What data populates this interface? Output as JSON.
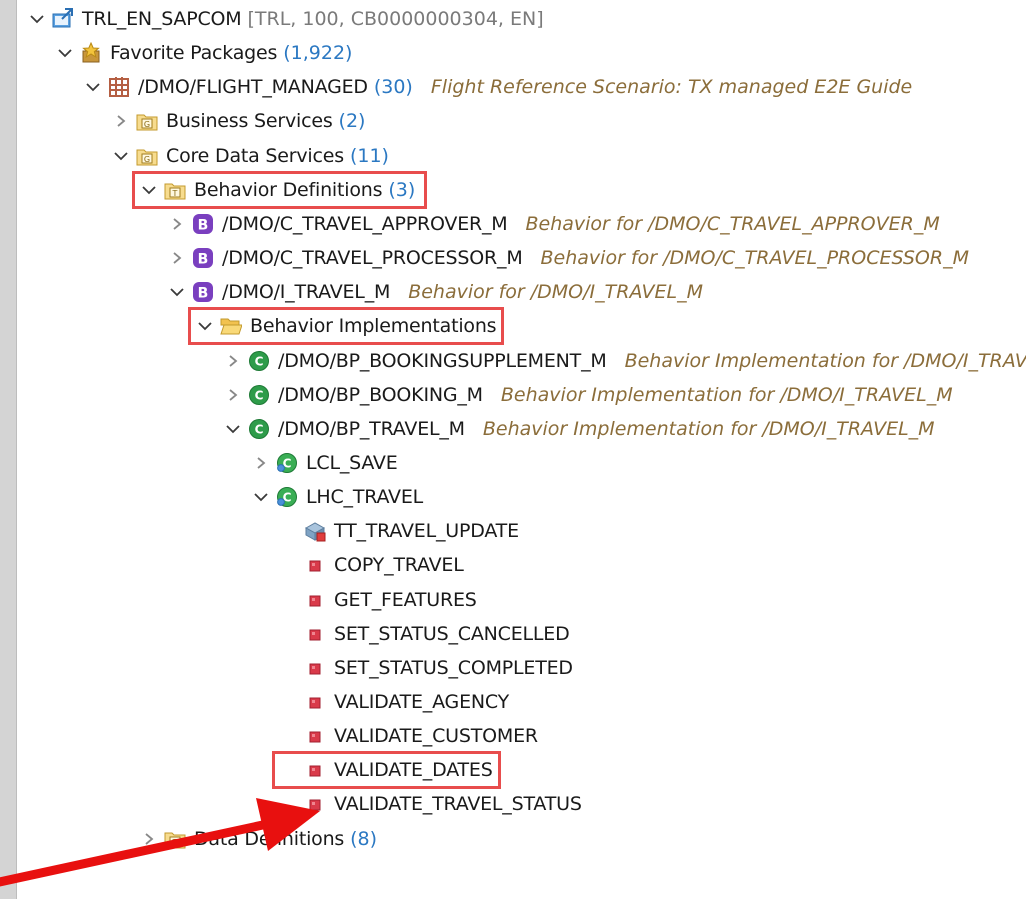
{
  "colors": {
    "highlight_box": "#e84d4d",
    "arrow": "#e8100f",
    "count_text": "#2b78c2",
    "description_text": "#8b6d3a"
  },
  "tree": [
    {
      "label": "TRL_EN_SAPCOM",
      "meta": "[TRL, 100, CB0000000304, EN]",
      "icon": "abap-project-icon",
      "expanded": true
    },
    {
      "label": "Favorite Packages",
      "count": "(1,922)",
      "icon": "favorite-packages-icon",
      "expanded": true
    },
    {
      "label": "/DMO/FLIGHT_MANAGED",
      "count": "(30)",
      "desc": "Flight Reference Scenario: TX managed E2E Guide",
      "icon": "package-icon",
      "expanded": true
    },
    {
      "label": "Business Services",
      "count": "(2)",
      "icon": "group-folder-icon",
      "expanded": false
    },
    {
      "label": "Core Data Services",
      "count": "(11)",
      "icon": "group-folder-icon",
      "expanded": true
    },
    {
      "label": "Behavior Definitions",
      "count": "(3)",
      "icon": "type-folder-icon",
      "expanded": true,
      "highlighted": true
    },
    {
      "label": "/DMO/C_TRAVEL_APPROVER_M",
      "desc": "Behavior for /DMO/C_TRAVEL_APPROVER_M",
      "icon": "behavior-definition-icon",
      "expanded": false
    },
    {
      "label": "/DMO/C_TRAVEL_PROCESSOR_M",
      "desc": "Behavior for /DMO/C_TRAVEL_PROCESSOR_M",
      "icon": "behavior-definition-icon",
      "expanded": false
    },
    {
      "label": "/DMO/I_TRAVEL_M",
      "desc": "Behavior for /DMO/I_TRAVEL_M",
      "icon": "behavior-definition-icon",
      "expanded": true
    },
    {
      "label": "Behavior Implementations",
      "icon": "open-folder-icon",
      "expanded": true,
      "highlighted": true
    },
    {
      "label": "/DMO/BP_BOOKINGSUPPLEMENT_M",
      "desc": "Behavior Implementation for /DMO/I_TRAVEL_M",
      "icon": "abap-class-icon",
      "expanded": false
    },
    {
      "label": "/DMO/BP_BOOKING_M",
      "desc": "Behavior Implementation for /DMO/I_TRAVEL_M",
      "icon": "abap-class-icon",
      "expanded": false
    },
    {
      "label": "/DMO/BP_TRAVEL_M",
      "desc": "Behavior Implementation for /DMO/I_TRAVEL_M",
      "icon": "abap-class-icon",
      "expanded": true
    },
    {
      "label": "LCL_SAVE",
      "icon": "local-class-icon",
      "expanded": false
    },
    {
      "label": "LHC_TRAVEL",
      "icon": "local-class-icon",
      "expanded": true
    },
    {
      "label": "TT_TRAVEL_UPDATE",
      "icon": "type-definition-icon"
    },
    {
      "label": "COPY_TRAVEL",
      "icon": "method-icon"
    },
    {
      "label": "GET_FEATURES",
      "icon": "method-icon"
    },
    {
      "label": "SET_STATUS_CANCELLED",
      "icon": "method-icon"
    },
    {
      "label": "SET_STATUS_COMPLETED",
      "icon": "method-icon"
    },
    {
      "label": "VALIDATE_AGENCY",
      "icon": "method-icon"
    },
    {
      "label": "VALIDATE_CUSTOMER",
      "icon": "method-icon"
    },
    {
      "label": "VALIDATE_DATES",
      "icon": "method-icon",
      "highlighted": true
    },
    {
      "label": "VALIDATE_TRAVEL_STATUS",
      "icon": "method-icon"
    },
    {
      "label": "Data Definitions",
      "count": "(8)",
      "icon": "type-folder-icon",
      "expanded": false
    }
  ]
}
